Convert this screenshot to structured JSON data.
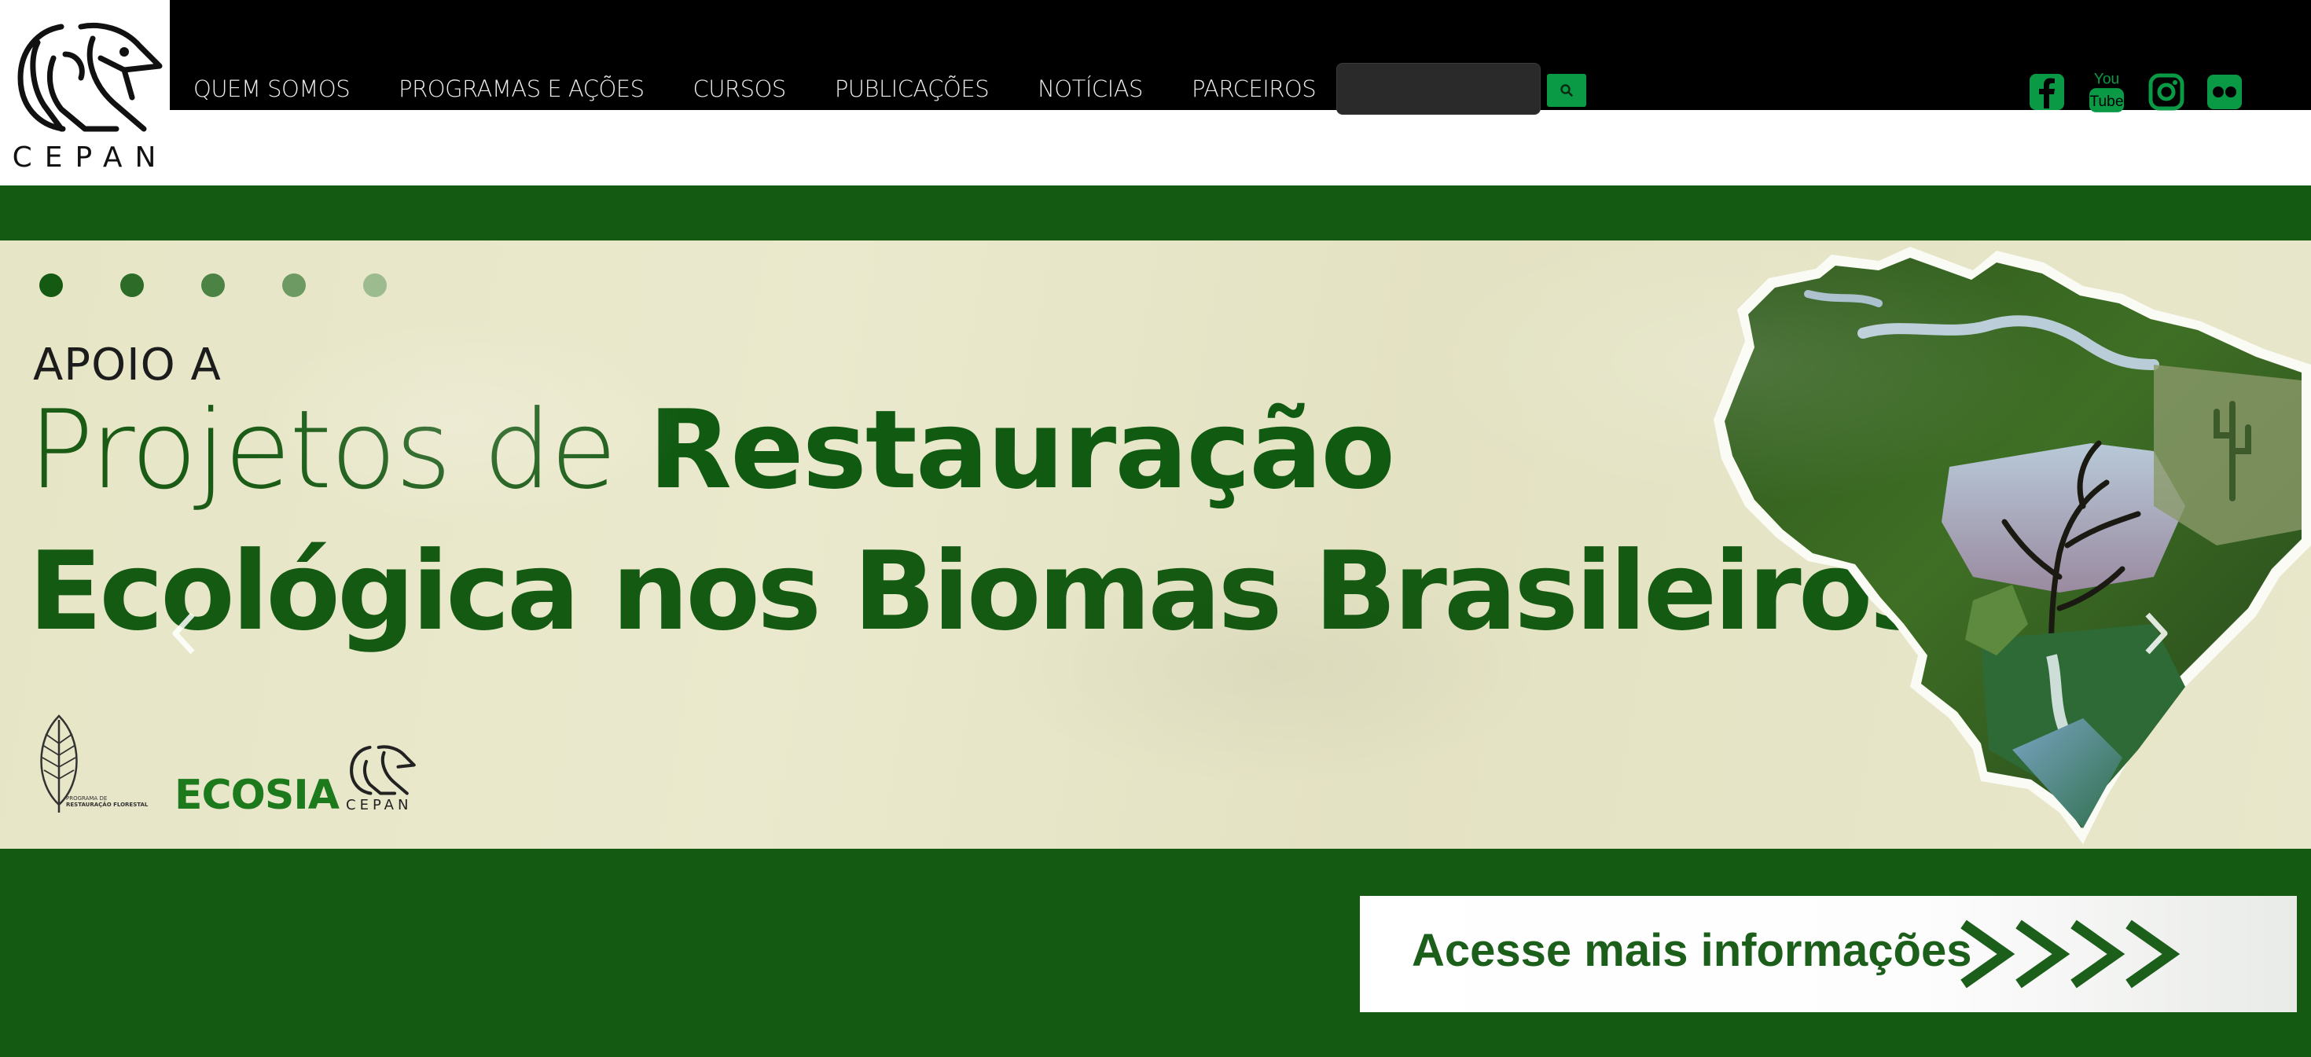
{
  "site": {
    "logo_text": "CEPAN",
    "logo_icon": "cepan-bird-logo-icon"
  },
  "nav": {
    "items": [
      {
        "label": "QUEM SOMOS"
      },
      {
        "label": "PROGRAMAS E AÇÕES"
      },
      {
        "label": "CURSOS"
      },
      {
        "label": "PUBLICAÇÕES"
      },
      {
        "label": "NOTÍCIAS"
      },
      {
        "label": "PARCEIROS"
      }
    ]
  },
  "search": {
    "value": "",
    "placeholder": "",
    "button_icon": "search-icon"
  },
  "social": [
    {
      "name": "facebook",
      "icon": "facebook-icon"
    },
    {
      "name": "youtube",
      "icon": "youtube-icon",
      "label_top": "You",
      "label_bottom": "Tube"
    },
    {
      "name": "instagram",
      "icon": "instagram-icon"
    },
    {
      "name": "flickr",
      "icon": "flickr-icon"
    }
  ],
  "carousel": {
    "slide_count": 5,
    "active_index": 0,
    "prev_icon": "chevron-left-icon",
    "next_icon": "chevron-right-icon",
    "slide": {
      "kicker": "APOIO A",
      "headline_light": "Projetos de ",
      "headline_bold": "Restauração",
      "headline_line2": "Ecológica nos Biomas Brasileiros",
      "partners": {
        "leaf_caption_line1": "PROGRAMA DE",
        "leaf_caption_line2": "RESTAURAÇÃO FLORESTAL",
        "ecosia": "ECOSIA",
        "cepan": "CEPAN"
      },
      "map_image": "brazil-biomes-map"
    }
  },
  "cta": {
    "label": "Acesse mais informações",
    "arrows_icon": "chevron-arrows-icon"
  },
  "colors": {
    "header_bg": "#000000",
    "brand_green": "#155a12",
    "search_button": "#0a9945",
    "social_green": "#0a9945",
    "slide_bg": "#e8e6c8"
  }
}
